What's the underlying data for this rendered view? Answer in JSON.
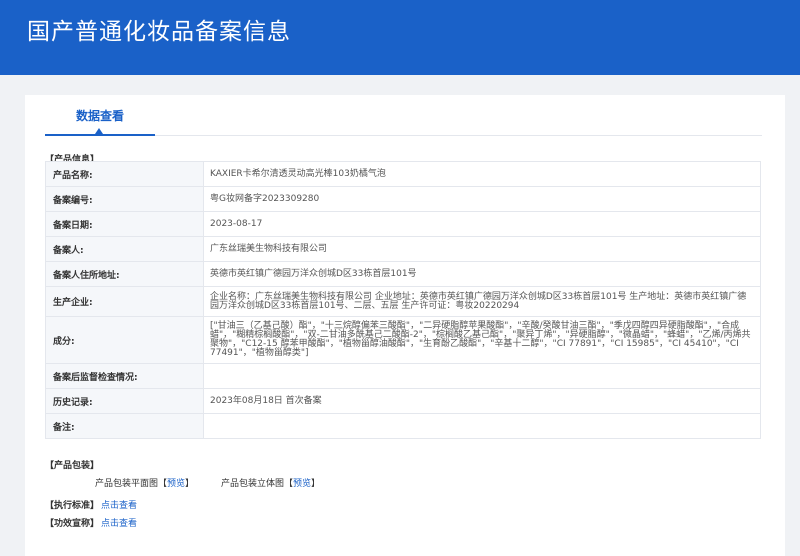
{
  "header": {
    "title": "国产普通化妆品备案信息"
  },
  "tab": {
    "label": "数据查看"
  },
  "product_info": {
    "section_title": "【产品信息】",
    "rows": [
      {
        "label": "产品名称:",
        "value": "KAXIER卡希尔清透灵动高光棒103奶橘气泡"
      },
      {
        "label": "备案编号:",
        "value": "粤G妆网备字2023309280"
      },
      {
        "label": "备案日期:",
        "value": "2023-08-17"
      },
      {
        "label": "备案人:",
        "value": "广东丝瑞美生物科技有限公司"
      },
      {
        "label": "备案人住所地址:",
        "value": "英德市英红镇广德园万洋众创城D区33栋首层101号"
      },
      {
        "label": "生产企业:",
        "value": "企业名称：广东丝瑞美生物科技有限公司 企业地址：英德市英红镇广德园万洋众创城D区33栋首层101号 生产地址：英德市英红镇广德园万洋众创城D区33栋首层101号、二层、五层 生产许可证：粤妆20220294"
      },
      {
        "label": "成分:",
        "value": "[\"甘油三（乙基己酸）酯\"，\"十三烷醇偏苯三酸酯\"，\"二异硬脂醇苹果酸酯\"，\"辛酸/癸酸甘油三酯\"，\"季戊四醇四异硬脂酸酯\"，\"合成蜡\"，\"糊精棕榈酸酯\"，\"双-二甘油多酰基己二酸酯-2\"，\"棕榈酸乙基己酯\"，\"聚异丁烯\"，\"异硬脂醇\"，\"微晶蜡\"，\"蜂蜡\"，\"乙烯/丙烯共聚物\"，\"C12-15 醇苯甲酸酯\"，\"植物甾醇油酸酯\"，\"生育酚乙酸酯\"，\"辛基十二醇\"，\"CI 77891\"，\"CI 15985\"，\"CI 45410\"，\"CI 77491\"，\"植物甾醇类\"]"
      },
      {
        "label": "备案后监督检查情况:",
        "value": ""
      },
      {
        "label": "历史记录:",
        "value": "2023年08月18日 首次备案"
      },
      {
        "label": "备注:",
        "value": ""
      }
    ]
  },
  "packaging": {
    "section_title": "【产品包装】",
    "flat_label": "产品包装平面图",
    "flat_link": "预览",
    "solid_label": "产品包装立体图",
    "solid_link": "预览",
    "bracket_open": "【",
    "bracket_close": "】"
  },
  "standard": {
    "section_title": "【执行标准】",
    "link": "点击查看"
  },
  "efficacy": {
    "section_title": "【功效宣称】",
    "link": "点击查看"
  }
}
